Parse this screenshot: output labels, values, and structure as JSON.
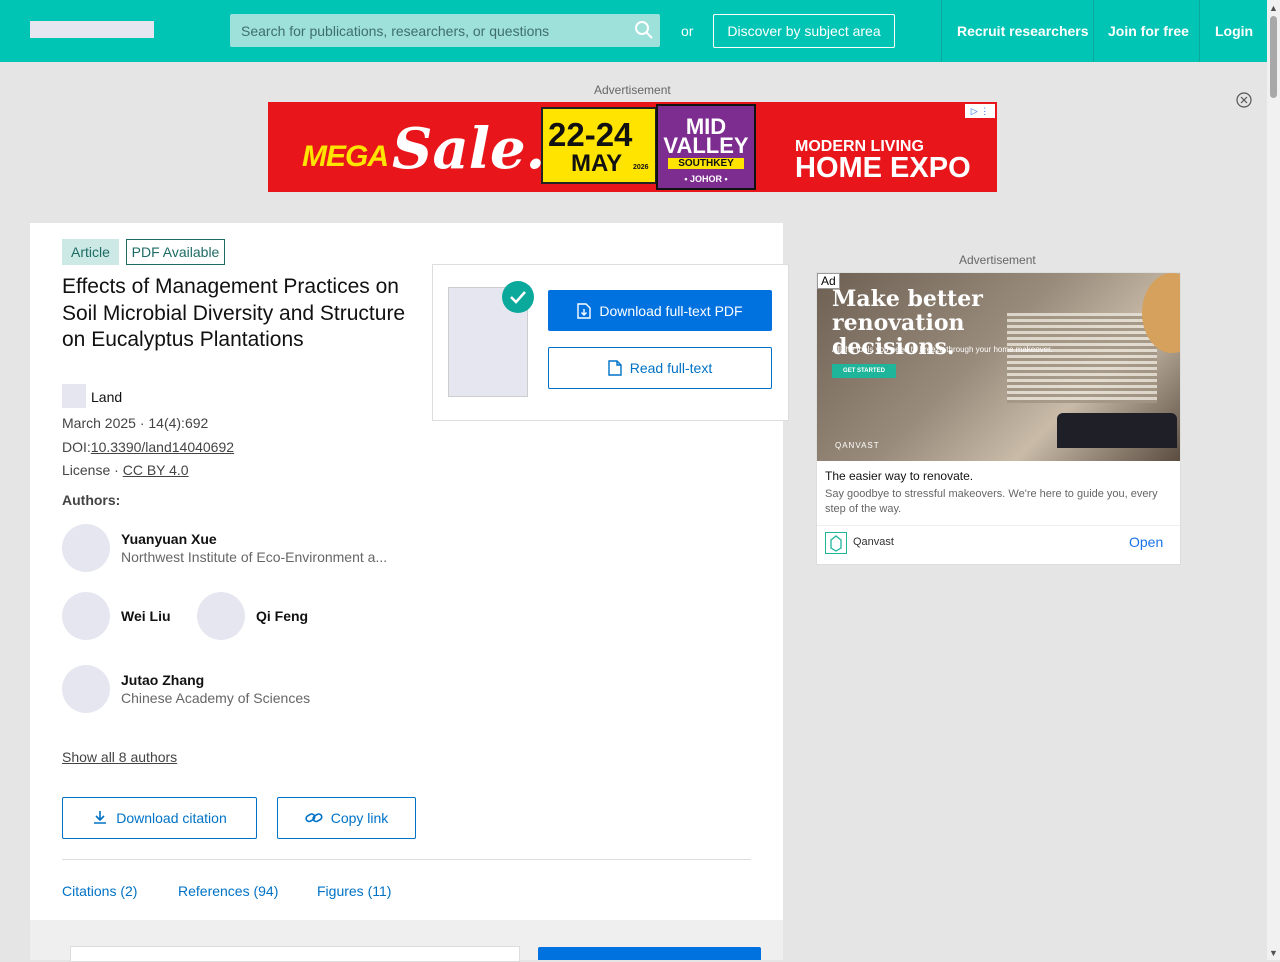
{
  "header": {
    "search_placeholder": "Search for publications, researchers, or questions",
    "or_text": "or",
    "discover_label": "Discover by subject area",
    "nav": [
      "Recruit researchers",
      "Join for free",
      "Login"
    ]
  },
  "ads": {
    "label": "Advertisement",
    "banner": {
      "mega": "MEGA",
      "sale": "Sale...",
      "dates": "22-24",
      "month": "MAY",
      "year": "2026",
      "mall1": "MID",
      "mall2": "VALLEY",
      "mall3": "SOUTHKEY",
      "mall4": "• JOHOR •",
      "expo1": "MODERN LIVING",
      "expo2": "HOME EXPO"
    },
    "side": {
      "ad_tag": "Ad",
      "headline_img": "Make better renovation decisions.",
      "sub_img": "All the tools you need to breeze through your home makeover.",
      "cta_img": "GET STARTED",
      "brand_img": "QANVAST",
      "headline": "The easier way to renovate.",
      "description": "Say goodbye to stressful makeovers. We're here to guide you, every step of the way.",
      "advertiser": "Qanvast",
      "open_label": "Open"
    }
  },
  "article": {
    "type_badge": "Article",
    "pdf_badge": "PDF Available",
    "title": "Effects of Management Practices on Soil Microbial Diversity and Structure on Eucalyptus Plantations",
    "journal": "Land",
    "date_line": "March 2025 · 14(4):692",
    "doi_prefix": "DOI:",
    "doi": "10.3390/land14040692",
    "license_prefix": "License · ",
    "license": "CC BY 4.0",
    "authors_heading": "Authors:",
    "authors": [
      {
        "name": "Yuanyuan Xue",
        "institution": "Northwest Institute of Eco-Environment a..."
      },
      {
        "name": "Wei Liu",
        "institution": ""
      },
      {
        "name": "Qi Feng",
        "institution": ""
      },
      {
        "name": "Jutao Zhang",
        "institution": "Chinese Academy of Sciences"
      }
    ],
    "show_all_authors": "Show all 8 authors",
    "download_citation": "Download citation",
    "copy_link": "Copy link",
    "tabs": [
      "Citations (2)",
      "References (94)",
      "Figures (11)"
    ]
  },
  "download_panel": {
    "download_pdf": "Download full-text PDF",
    "read_full_text": "Read full-text"
  },
  "colors": {
    "brand": "#00c4b4",
    "primary": "#0072e0",
    "link": "#0072c6"
  }
}
